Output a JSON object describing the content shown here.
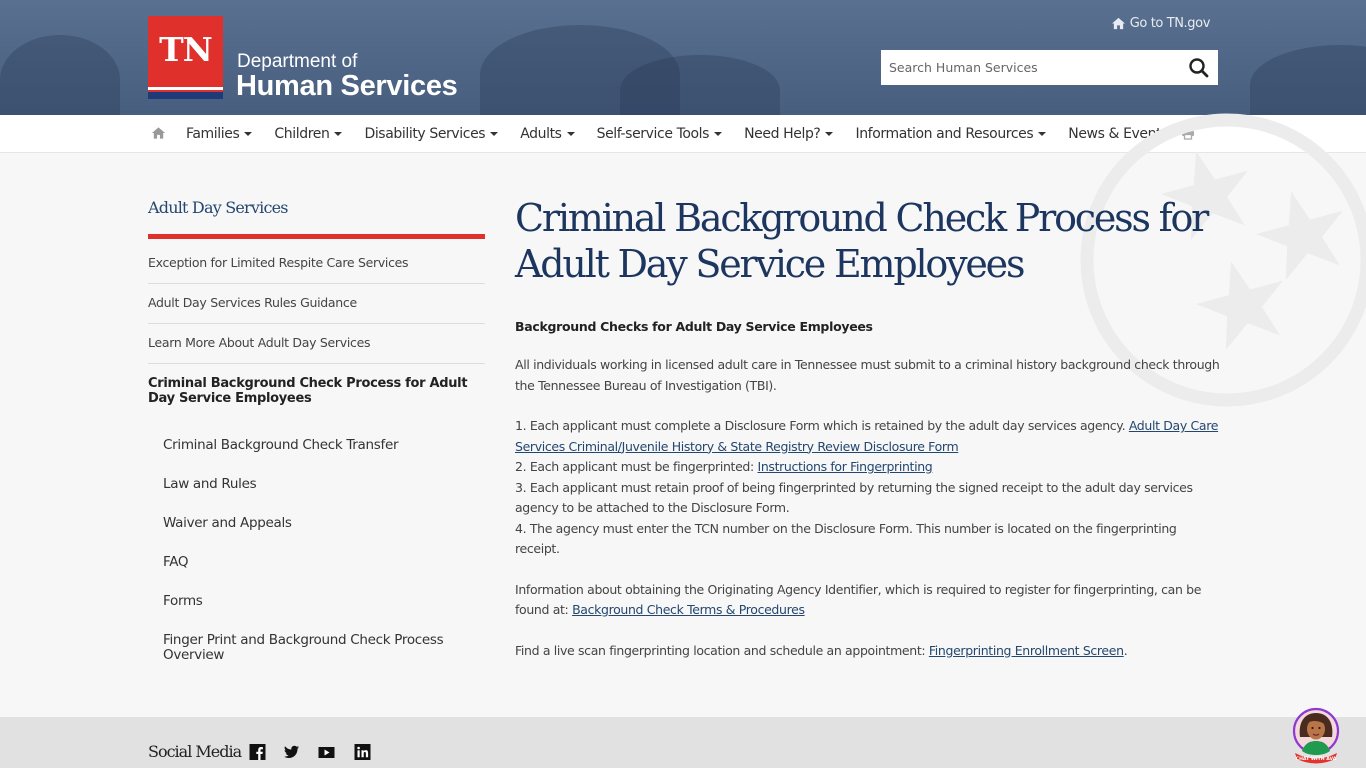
{
  "header": {
    "logo_text": "TN",
    "dept_line1": "Department of",
    "dept_line2": "Human Services",
    "go_tn_label": "Go to TN.gov",
    "search_placeholder": "Search Human Services"
  },
  "nav": {
    "items": [
      {
        "label": "Families"
      },
      {
        "label": "Children"
      },
      {
        "label": "Disability Services"
      },
      {
        "label": "Adults"
      },
      {
        "label": "Self-service Tools"
      },
      {
        "label": "Need Help?"
      },
      {
        "label": "Information and Resources"
      },
      {
        "label": "News & Events"
      }
    ]
  },
  "sidebar": {
    "title": "Adult Day Services",
    "items": [
      {
        "label": "Exception for Limited Respite Care Services"
      },
      {
        "label": "Adult Day Services Rules Guidance"
      },
      {
        "label": "Learn More About Adult Day Services"
      },
      {
        "label": "Criminal Background Check Process for Adult Day Service Employees"
      }
    ],
    "subitems": [
      {
        "label": "Criminal Background Check Transfer"
      },
      {
        "label": "Law and Rules"
      },
      {
        "label": "Waiver and Appeals"
      },
      {
        "label": "FAQ"
      },
      {
        "label": "Forms"
      },
      {
        "label": "Finger Print and Background Check Process Overview"
      }
    ]
  },
  "main": {
    "title": "Criminal Background Check Process for Adult Day Service Employees",
    "subhead": "Background Checks for Adult Day Service Employees",
    "intro": "All individuals working in licensed adult care in Tennessee must submit to a criminal history background check through the Tennessee Bureau of Investigation (TBI).",
    "step1_text": "1. Each applicant must complete a Disclosure Form which is retained by the adult day services agency.  ",
    "step1_link": "Adult Day Care Services Criminal/Juvenile History & State Registry Review Disclosure Form",
    "step2_text": "2. Each applicant must be fingerprinted: ",
    "step2_link": "Instructions for Fingerprinting",
    "step3_text": "3. Each applicant must retain proof of being fingerprinted by returning the signed receipt to the adult day services agency to be attached to the Disclosure Form.",
    "step4_text": "4. The agency must enter the TCN number on the Disclosure Form. This number is located on the fingerprinting receipt.",
    "oai_text": "Information about obtaining the Originating Agency Identifier, which is required to register for fingerprinting, can be found at: ",
    "oai_link": "Background Check Terms & Procedures",
    "live_text": "Find a live scan fingerprinting location and schedule an appointment: ",
    "live_link": "Fingerprinting Enrollment Screen",
    "live_end": "."
  },
  "footer": {
    "social_label": "Social Media",
    "icons": [
      "facebook-icon",
      "twitter-icon",
      "youtube-icon",
      "linkedin-icon"
    ]
  },
  "chat": {
    "label": "CHAT WITH AVA"
  },
  "colors": {
    "brand_red": "#e0302c",
    "brand_navy": "#1c3660",
    "header_bg": "#4e6585"
  }
}
